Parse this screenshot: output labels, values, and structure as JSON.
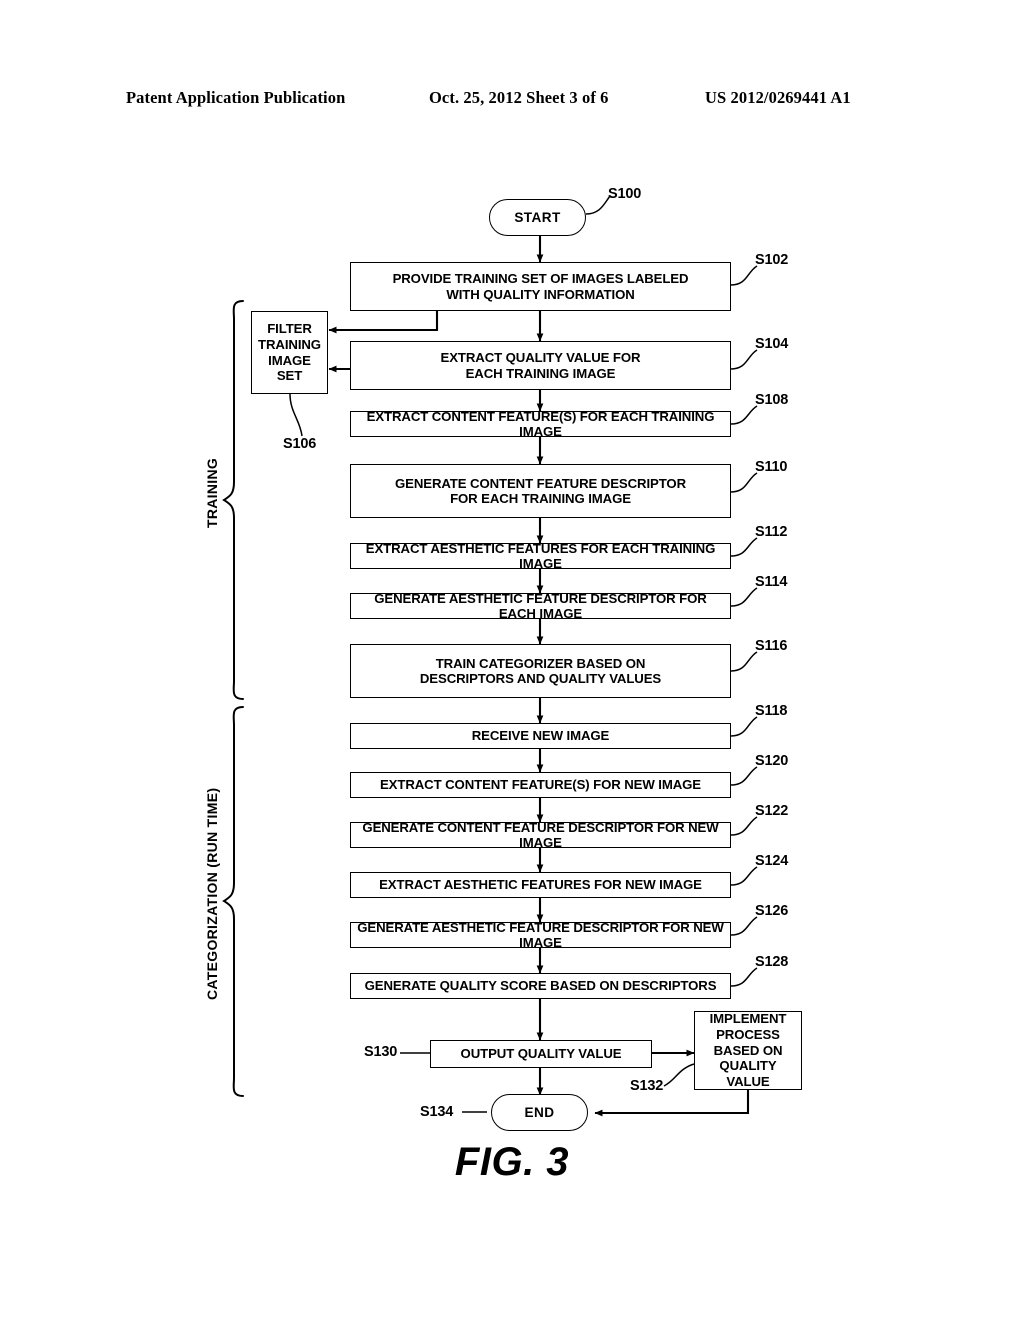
{
  "header": {
    "publication": "Patent Application Publication",
    "date_sheet": "Oct. 25, 2012   Sheet 3 of 6",
    "patent_number": "US 2012/0269441 A1"
  },
  "figure": {
    "caption": "FIG. 3",
    "type": "flowchart"
  },
  "phases": [
    {
      "id": "training",
      "label": "TRAINING"
    },
    {
      "id": "categorization",
      "label": "CATEGORIZATION (RUN TIME)"
    }
  ],
  "nodes": [
    {
      "id": "S100",
      "step": "S100",
      "shape": "terminator",
      "text": "START"
    },
    {
      "id": "S102",
      "step": "S102",
      "shape": "process",
      "text": "PROVIDE TRAINING SET OF IMAGES LABELED\nWITH QUALITY INFORMATION"
    },
    {
      "id": "S106",
      "step": "S106",
      "shape": "process",
      "text": "FILTER\nTRAINING\nIMAGE SET"
    },
    {
      "id": "S104",
      "step": "S104",
      "shape": "process",
      "text": "EXTRACT QUALITY VALUE FOR\nEACH TRAINING IMAGE"
    },
    {
      "id": "S108",
      "step": "S108",
      "shape": "process",
      "text": "EXTRACT CONTENT FEATURE(S) FOR EACH TRAINING  IMAGE"
    },
    {
      "id": "S110",
      "step": "S110",
      "shape": "process",
      "text": "GENERATE CONTENT FEATURE DESCRIPTOR\nFOR EACH TRAINING IMAGE"
    },
    {
      "id": "S112",
      "step": "S112",
      "shape": "process",
      "text": "EXTRACT AESTHETIC FEATURES FOR EACH TRAINING  IMAGE"
    },
    {
      "id": "S114",
      "step": "S114",
      "shape": "process",
      "text": "GENERATE AESTHETIC FEATURE DESCRIPTOR  FOR EACH IMAGE"
    },
    {
      "id": "S116",
      "step": "S116",
      "shape": "process",
      "text": "TRAIN CATEGORIZER BASED ON\nDESCRIPTORS AND QUALITY VALUES"
    },
    {
      "id": "S118",
      "step": "S118",
      "shape": "process",
      "text": "RECEIVE NEW IMAGE"
    },
    {
      "id": "S120",
      "step": "S120",
      "shape": "process",
      "text": "EXTRACT CONTENT FEATURE(S) FOR NEW IMAGE"
    },
    {
      "id": "S122",
      "step": "S122",
      "shape": "process",
      "text": "GENERATE CONTENT FEATURE DESCRIPTOR FOR NEW  IMAGE"
    },
    {
      "id": "S124",
      "step": "S124",
      "shape": "process",
      "text": "EXTRACT AESTHETIC FEATURES FOR NEW IMAGE"
    },
    {
      "id": "S126",
      "step": "S126",
      "shape": "process",
      "text": "GENERATE AESTHETIC FEATURE DESCRIPTOR FOR NEW IMAGE"
    },
    {
      "id": "S128",
      "step": "S128",
      "shape": "process",
      "text": "GENERATE  QUALITY SCORE BASED ON DESCRIPTORS"
    },
    {
      "id": "S130",
      "step": "S130",
      "shape": "process",
      "text": "OUTPUT  QUALITY VALUE"
    },
    {
      "id": "S132",
      "step": "S132",
      "shape": "process",
      "text": "IMPLEMENT\nPROCESS\nBASED ON\nQUALITY VALUE"
    },
    {
      "id": "S134",
      "step": "S134",
      "shape": "terminator",
      "text": "END"
    }
  ],
  "edges": [
    {
      "from": "S100",
      "to": "S102"
    },
    {
      "from": "S102",
      "to": "S104"
    },
    {
      "from": "S102",
      "to": "S106"
    },
    {
      "from": "S104",
      "to": "S106"
    },
    {
      "from": "S104",
      "to": "S108"
    },
    {
      "from": "S108",
      "to": "S110"
    },
    {
      "from": "S110",
      "to": "S112"
    },
    {
      "from": "S112",
      "to": "S114"
    },
    {
      "from": "S114",
      "to": "S116"
    },
    {
      "from": "S116",
      "to": "S118"
    },
    {
      "from": "S118",
      "to": "S120"
    },
    {
      "from": "S120",
      "to": "S122"
    },
    {
      "from": "S122",
      "to": "S124"
    },
    {
      "from": "S124",
      "to": "S126"
    },
    {
      "from": "S126",
      "to": "S128"
    },
    {
      "from": "S128",
      "to": "S130"
    },
    {
      "from": "S130",
      "to": "S132"
    },
    {
      "from": "S130",
      "to": "S134"
    },
    {
      "from": "S132",
      "to": "S134"
    }
  ],
  "colors": {
    "ink": "#000000",
    "paper": "#ffffff"
  }
}
